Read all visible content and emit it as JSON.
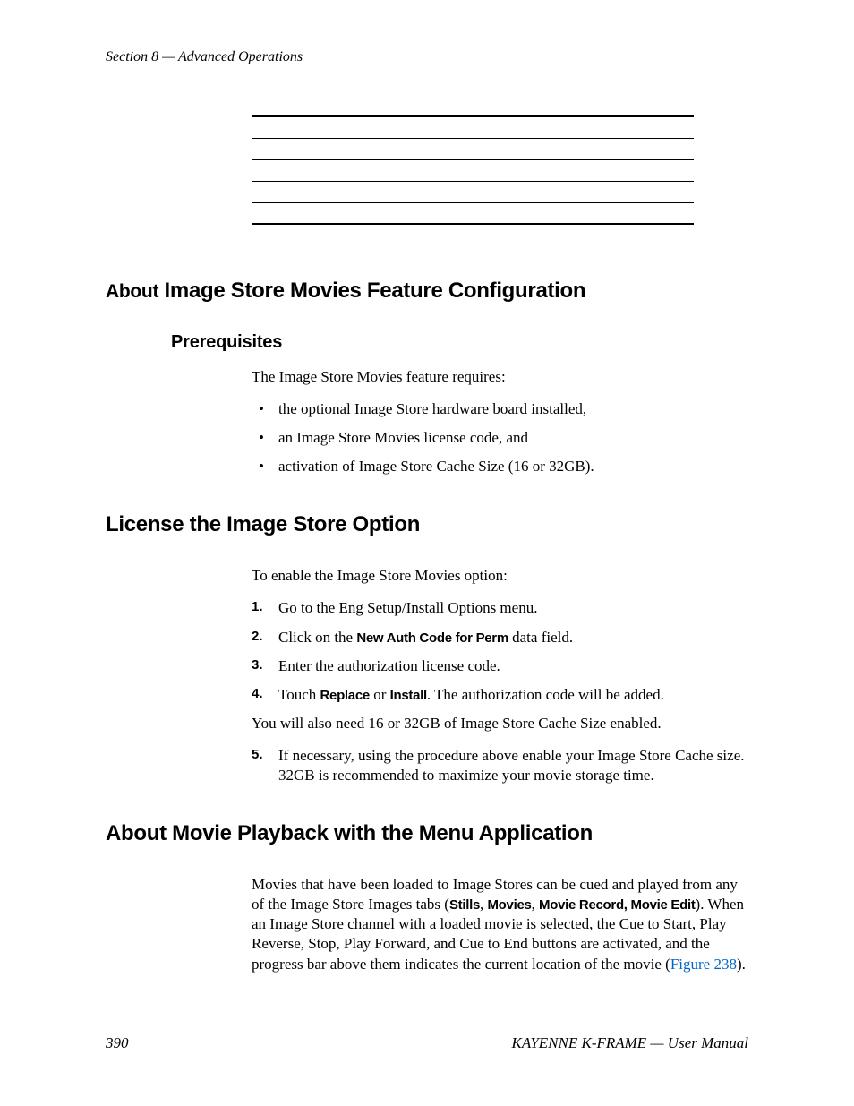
{
  "header": "Section 8 — Advanced Operations",
  "section1": {
    "title_light": "About",
    "title_bold": "Image Store Movies Feature Configuration",
    "sub1": {
      "title": "Prerequisites",
      "intro": "The Image Store Movies feature requires:",
      "bullets": [
        "the optional Image Store hardware board installed,",
        "an Image Store Movies license code, and",
        "activation of Image Store Cache Size (16 or 32GB)."
      ]
    }
  },
  "section2": {
    "title": "License the Image Store Option",
    "intro": "To enable the Image Store Movies option:",
    "steps": {
      "s1": "Go to the Eng Setup/Install Options menu.",
      "s2_a": "Click on the ",
      "s2_b": "New Auth Code for Perm",
      "s2_c": " data field.",
      "s3": "Enter the authorization license code.",
      "s4_a": "Touch ",
      "s4_b": "Replace",
      "s4_c": " or ",
      "s4_d": "Install",
      "s4_e": ". The authorization code will be added.",
      "mid": "You will also need 16 or 32GB of Image Store Cache Size enabled.",
      "s5": "If necessary, using the procedure above enable your Image Store Cache size. 32GB is recommended to maximize your movie storage time."
    }
  },
  "section3": {
    "title": "About Movie Playback with the Menu Application",
    "p1_a": "Movies that have been loaded to Image Stores can be cued and played from any of the Image Store Images tabs (",
    "p1_b": "Stills",
    "p1_c": ", ",
    "p1_d": "Movies",
    "p1_e": ", ",
    "p1_f": "Movie Record, Movie Edit",
    "p1_g": "). When an Image Store channel with a loaded movie is selected, the Cue to Start, Play Reverse, Stop, Play Forward, and Cue to End buttons are activated, and the progress bar above them indicates the current location of the movie (",
    "p1_h": "Figure 238",
    "p1_i": ")."
  },
  "footer": {
    "page": "390",
    "doc": "KAYENNE K-FRAME — User Manual"
  }
}
